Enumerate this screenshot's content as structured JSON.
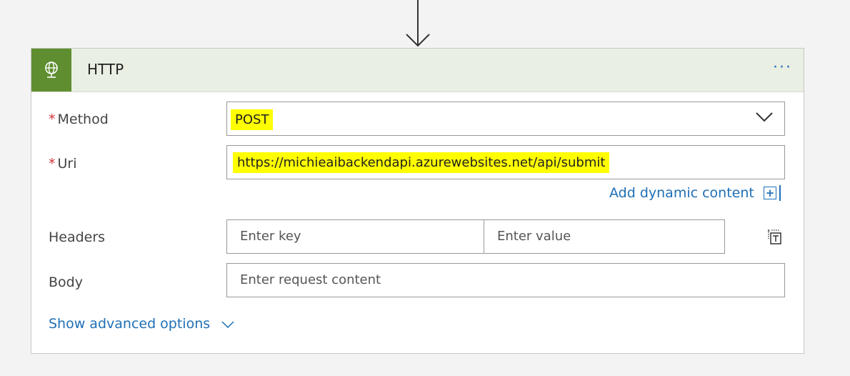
{
  "card": {
    "title": "HTTP",
    "menu_label": "···"
  },
  "fields": {
    "method": {
      "label": "Method",
      "required_mark": "*",
      "value": "POST"
    },
    "uri": {
      "label": "Uri",
      "required_mark": "*",
      "value": "https://michieaibackendapi.azurewebsites.net/api/submit",
      "dynamic_content_label": "Add dynamic content"
    },
    "headers": {
      "label": "Headers",
      "key_placeholder": "Enter key",
      "value_placeholder": "Enter value"
    },
    "body": {
      "label": "Body",
      "placeholder": "Enter request content"
    }
  },
  "advanced": {
    "label": "Show advanced options"
  },
  "colors": {
    "header_bg": "#e9efe2",
    "icon_bg": "#5e8e2f",
    "link": "#1f6fb5",
    "required": "#d13438",
    "highlight": "#ffff00"
  },
  "icons": [
    "down-arrow-icon",
    "globe-icon",
    "more-icon",
    "chevron-down-icon",
    "add-dynamic-content-icon",
    "text-mode-icon"
  ]
}
